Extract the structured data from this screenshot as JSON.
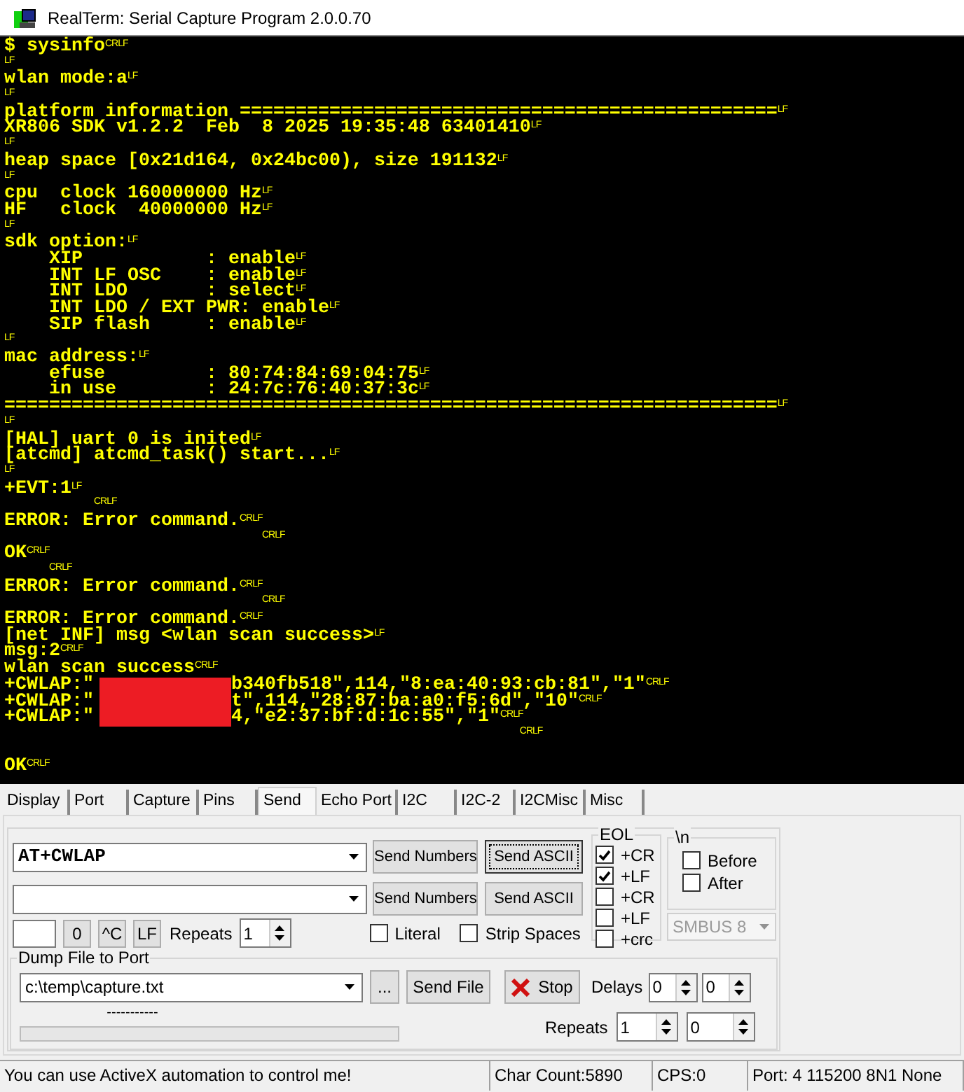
{
  "window": {
    "title": "RealTerm: Serial Capture Program 2.0.0.70"
  },
  "terminal": {
    "lines": [
      {
        "text": "$ sysinfo",
        "eol": "CRLF"
      },
      {
        "eol": "LF"
      },
      {
        "text": "wlan mode:a",
        "eol": "LF"
      },
      {
        "eol": "LF"
      },
      {
        "text": "platform information ================================================",
        "eol": "LF"
      },
      {
        "text": "XR806 SDK v1.2.2  Feb  8 2025 19:35:48 63401410",
        "eol": "LF"
      },
      {
        "eol": "LF"
      },
      {
        "text": "heap space [0x21d164, 0x24bc00), size 191132",
        "eol": "LF"
      },
      {
        "eol": "LF"
      },
      {
        "text": "cpu  clock 160000000 Hz",
        "eol": "LF"
      },
      {
        "text": "HF   clock  40000000 Hz",
        "eol": "LF"
      },
      {
        "eol": "LF"
      },
      {
        "text": "sdk option:",
        "eol": "LF"
      },
      {
        "text": "    XIP           : enable",
        "eol": "LF"
      },
      {
        "text": "    INT LF OSC    : enable",
        "eol": "LF"
      },
      {
        "text": "    INT LDO       : select",
        "eol": "LF"
      },
      {
        "text": "    INT LDO / EXT PWR: enable",
        "eol": "LF"
      },
      {
        "text": "    SIP flash     : enable",
        "eol": "LF"
      },
      {
        "eol": "LF"
      },
      {
        "text": "mac address:",
        "eol": "LF"
      },
      {
        "text": "    efuse         : 80:74:84:69:04:75",
        "eol": "LF"
      },
      {
        "text": "    in use        : 24:7c:76:40:37:3c",
        "eol": "LF"
      },
      {
        "text": "=====================================================================",
        "eol": "LF"
      },
      {
        "eol": "LF"
      },
      {
        "text": "[HAL] uart 0 is inited",
        "eol": "LF"
      },
      {
        "text": "[atcmd] atcmd_task() start...",
        "eol": "LF"
      },
      {
        "eol": "LF"
      },
      {
        "text": "+EVT:1",
        "eol": "LF"
      },
      {
        "kind": "echo",
        "eol": "CRLF"
      },
      {
        "text": "ERROR: Error command.",
        "eol": "CRLF"
      },
      {
        "kind": "echo",
        "eol": "CRLF"
      },
      {
        "text": "OK",
        "eol": "CRLF"
      },
      {
        "kind": "echo",
        "eol": "CRLF"
      },
      {
        "text": "ERROR: Error command.",
        "eol": "CRLF"
      },
      {
        "kind": "echo",
        "eol": "CRLF"
      },
      {
        "text": "ERROR: Error command.",
        "eol": "CRLF"
      },
      {
        "text": "[net INF] msg <wlan scan success>",
        "eol": "LF"
      },
      {
        "text": "msg:2",
        "eol": "CRLF"
      },
      {
        "text": "wlan scan success",
        "eol": "CRLF"
      },
      {
        "text": "+CWLAP:\"",
        "redacted": true,
        "after": "b340fb518\",114,\"8:ea:40:93:cb:81\",\"1\"",
        "eol": "CRLF"
      },
      {
        "text": "+CWLAP:\"",
        "redacted": true,
        "after": "t\",114,\"28:87:ba:a0:f5:6d\",\"10\"",
        "eol": "CRLF"
      },
      {
        "text": "+CWLAP:\"",
        "redacted": true,
        "after": "4,\"e2:37:bf:d:1c:55\",\"1\"",
        "eol": "CRLF"
      },
      {
        "kind": "echo",
        "eol": "CRLF"
      },
      {
        "kind": "blank"
      },
      {
        "text": "OK",
        "eol": "CRLF"
      }
    ]
  },
  "tabs": [
    {
      "label": "Display",
      "selected": false
    },
    {
      "label": "Port",
      "selected": false
    },
    {
      "label": "Capture",
      "selected": false
    },
    {
      "label": "Pins",
      "selected": false
    },
    {
      "label": "Send",
      "selected": true
    },
    {
      "label": "Echo Port",
      "selected": false
    },
    {
      "label": "I2C",
      "selected": false
    },
    {
      "label": "I2C-2",
      "selected": false
    },
    {
      "label": "I2CMisc",
      "selected": false
    },
    {
      "label": "Misc",
      "selected": false
    }
  ],
  "send": {
    "command_1": {
      "value": "AT+CWLAP"
    },
    "buttons_1": [
      {
        "label": "Send Numbers",
        "focused": false
      },
      {
        "label": "Send ASCII",
        "focused": true
      }
    ],
    "buttons_2": [
      {
        "label": "Send Numbers",
        "focused": false
      },
      {
        "label": "Send ASCII",
        "focused": false
      }
    ],
    "small_buttons": [
      "0",
      "^C",
      "LF"
    ],
    "repeats": {
      "label": "Repeats",
      "value": "1"
    },
    "options": [
      {
        "label": "Literal",
        "checked": false
      },
      {
        "label": "Strip Spaces",
        "checked": false
      }
    ],
    "eol": {
      "title": "EOL",
      "items": [
        {
          "label": "+CR",
          "checked": true
        },
        {
          "label": "+LF",
          "checked": true
        },
        {
          "label": "+CR",
          "checked": false
        },
        {
          "label": "+LF",
          "checked": false
        },
        {
          "label": "+crc",
          "checked": false
        }
      ]
    },
    "newline": {
      "title": "\\n",
      "items": [
        {
          "label": "Before",
          "checked": false
        },
        {
          "label": "After",
          "checked": false
        }
      ]
    },
    "bus_select": {
      "value": "SMBUS 8",
      "disabled": true
    }
  },
  "dump": {
    "title": "Dump File to Port",
    "file": "c:\\temp\\capture.txt",
    "browse": "...",
    "send_file": "Send File",
    "stop": "Stop",
    "delays": {
      "label": "Delays",
      "values": [
        "0",
        "0"
      ]
    },
    "progress_text": "-----------",
    "progress": {
      "level": 0
    },
    "repeats": {
      "label": "Repeats",
      "values": [
        "1",
        "0"
      ]
    }
  },
  "status_bar": [
    "You can use ActiveX automation to control me!",
    "Char Count:5890",
    "CPS:0",
    "Port: 4 115200 8N1 None"
  ]
}
